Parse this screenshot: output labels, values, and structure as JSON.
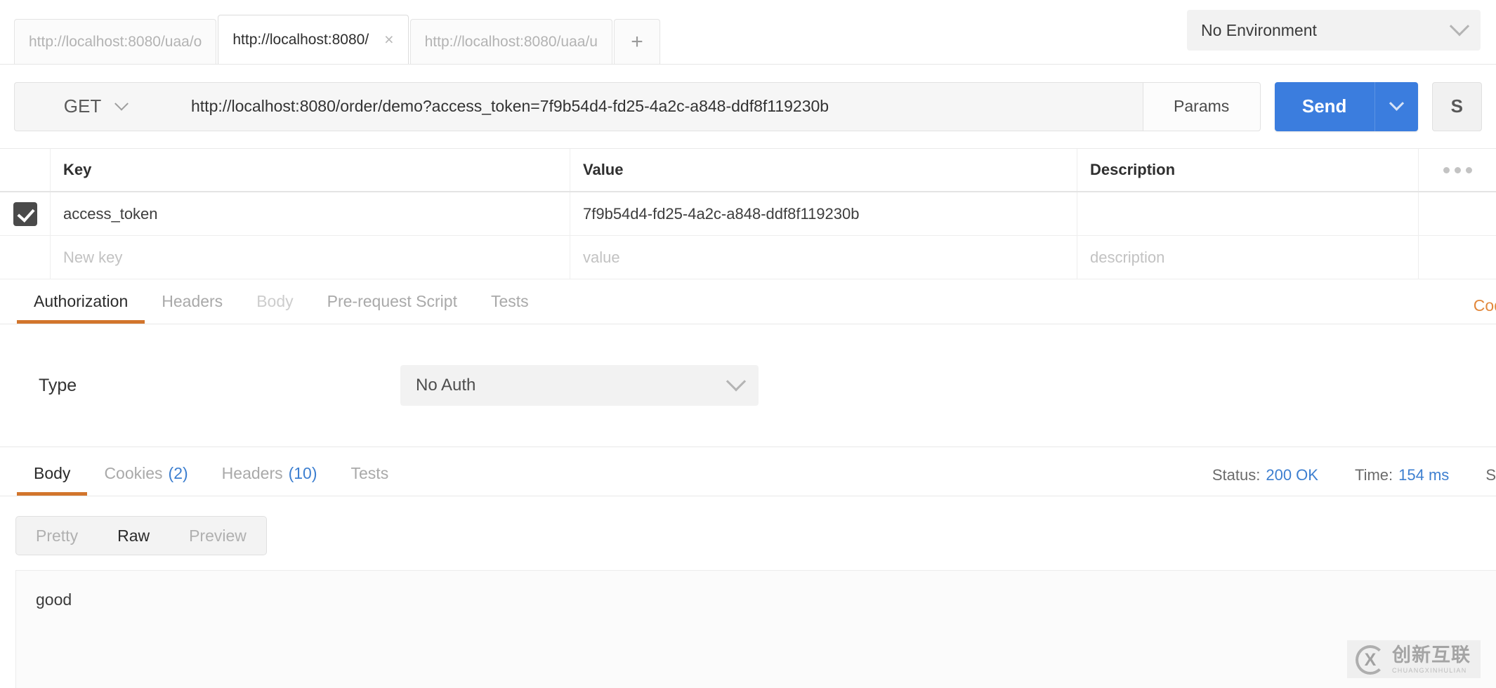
{
  "tabbar": {
    "tabs": [
      {
        "label": "http://localhost:8080/uaa/o",
        "active": false
      },
      {
        "label": "http://localhost:8080/",
        "active": true,
        "close": "×"
      },
      {
        "label": "http://localhost:8080/uaa/u",
        "active": false
      }
    ],
    "add_label": "+",
    "environment": {
      "selected": "No Environment"
    }
  },
  "urlbar": {
    "method": "GET",
    "url": "http://localhost:8080/order/demo?access_token=7f9b54d4-fd25-4a2c-a848-ddf8f119230b",
    "params_label": "Params",
    "send_label": "Send",
    "save_label": "S"
  },
  "params": {
    "columns": [
      "Key",
      "Value",
      "Description"
    ],
    "rows": [
      {
        "checked": true,
        "key": "access_token",
        "value": "7f9b54d4-fd25-4a2c-a848-ddf8f119230b",
        "description": ""
      }
    ],
    "new_row": {
      "key_placeholder": "New key",
      "value_placeholder": "value",
      "description_placeholder": "description"
    }
  },
  "request_tabs": {
    "items": [
      {
        "label": "Authorization",
        "state": "active"
      },
      {
        "label": "Headers",
        "state": "normal"
      },
      {
        "label": "Body",
        "state": "dim"
      },
      {
        "label": "Pre-request Script",
        "state": "normal"
      },
      {
        "label": "Tests",
        "state": "normal"
      }
    ],
    "code_link": "Cod"
  },
  "auth": {
    "type_label": "Type",
    "type_value": "No Auth"
  },
  "response_tabs": {
    "items": [
      {
        "label": "Body",
        "count": "",
        "state": "active"
      },
      {
        "label": "Cookies",
        "count": "(2)",
        "state": "normal"
      },
      {
        "label": "Headers",
        "count": "(10)",
        "state": "normal"
      },
      {
        "label": "Tests",
        "count": "",
        "state": "normal"
      }
    ],
    "status_label": "Status:",
    "status_value": "200 OK",
    "time_label": "Time:",
    "time_value": "154 ms",
    "size_label": "S"
  },
  "response_body": {
    "view_modes": [
      {
        "label": "Pretty",
        "active": false
      },
      {
        "label": "Raw",
        "active": true
      },
      {
        "label": "Preview",
        "active": false
      }
    ],
    "content": "good"
  },
  "watermark": {
    "mark": "X",
    "cn": "创新互联",
    "en": "CHUANGXINHULIAN"
  },
  "colors": {
    "accent_orange": "#d2752c",
    "send_blue": "#3b7dde",
    "link_blue": "#3d7fd0",
    "code_orange": "#e2883c"
  }
}
